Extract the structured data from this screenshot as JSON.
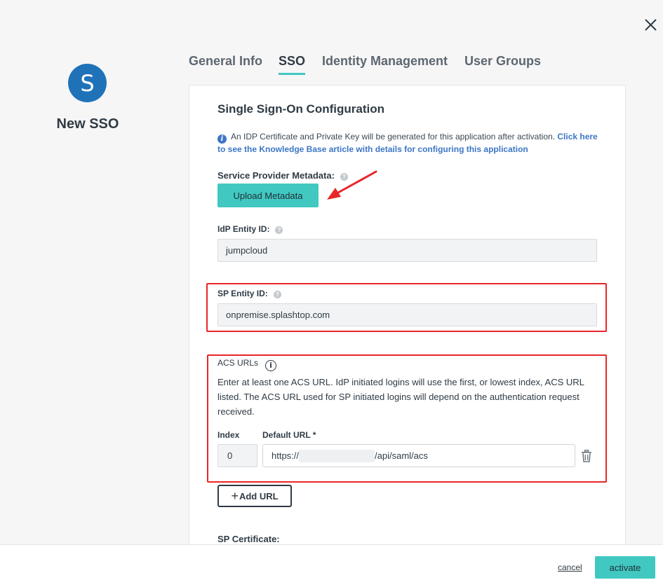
{
  "app": {
    "avatar_letter": "S",
    "name": "New SSO"
  },
  "tabs": [
    {
      "label": "General Info",
      "active": false
    },
    {
      "label": "SSO",
      "active": true
    },
    {
      "label": "Identity Management",
      "active": false
    },
    {
      "label": "User Groups",
      "active": false
    }
  ],
  "sso": {
    "section_title": "Single Sign-On Configuration",
    "info_note_text": "An IDP Certificate and Private Key will be generated for this application after activation. ",
    "info_note_link_1": "Click here",
    "info_note_link_2": "to see the Knowledge Base article with details for configuring this application",
    "sp_metadata_label": "Service Provider Metadata:",
    "upload_metadata_button": "Upload Metadata",
    "idp_entity_label": "IdP Entity ID:",
    "idp_entity_value": "jumpcloud",
    "sp_entity_label": "SP Entity ID:",
    "sp_entity_value": "onpremise.splashtop.com",
    "acs_label": "ACS URLs",
    "acs_description": "Enter at least one ACS URL. IdP initiated logins will use the first, or lowest index, ACS URL listed. The ACS URL used for SP initiated logins will depend on the authentication request received.",
    "index_header": "Index",
    "default_url_header": "Default URL *",
    "acs_rows": [
      {
        "index": "0",
        "url_prefix": "https://",
        "url_suffix": "/api/saml/acs"
      }
    ],
    "add_url_button": "Add URL",
    "sp_certificate_label": "SP Certificate:"
  },
  "footer": {
    "cancel_label": "cancel",
    "activate_label": "activate"
  },
  "colors": {
    "accent": "#41c8c1",
    "avatar": "#1f72b8",
    "link": "#3c76c6",
    "highlight": "#e8262a"
  },
  "icons": {
    "close": "close-icon",
    "info": "info-icon",
    "help": "help-icon",
    "trash": "trash-icon",
    "plus": "plus-icon",
    "arrow": "annotation-arrow"
  }
}
